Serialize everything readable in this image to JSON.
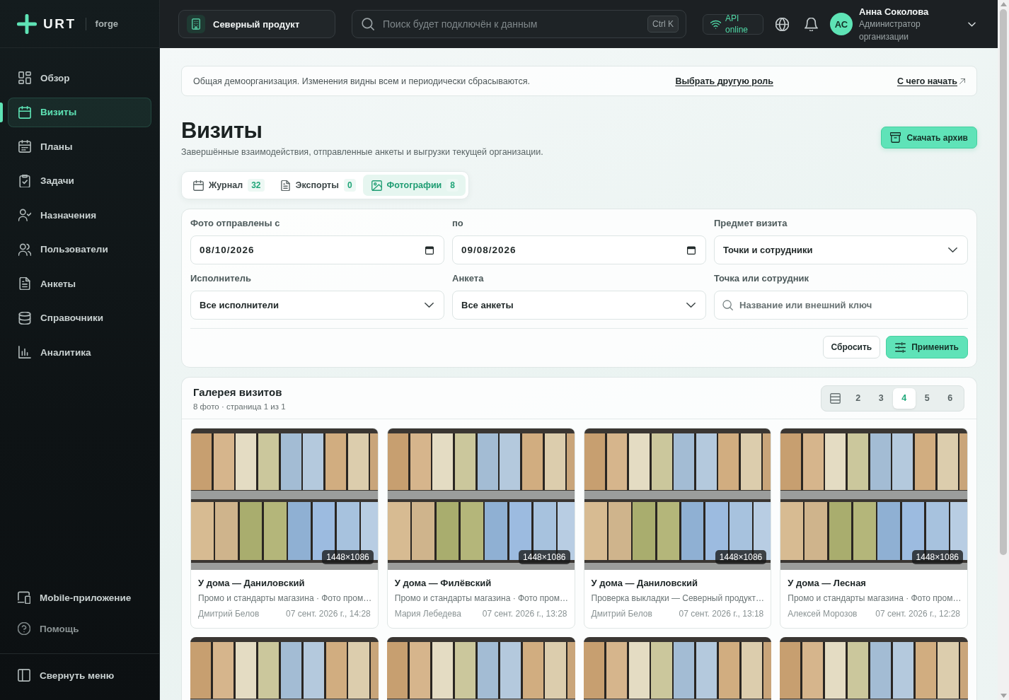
{
  "sidebar": {
    "brand": "URT",
    "product": "forge",
    "nav": [
      {
        "label": "Обзор",
        "selected": false
      },
      {
        "label": "Визиты",
        "selected": true
      },
      {
        "label": "Планы",
        "selected": false
      },
      {
        "label": "Задачи",
        "selected": false
      },
      {
        "label": "Назначения",
        "selected": false
      },
      {
        "label": "Пользователи",
        "selected": false
      },
      {
        "label": "Анкеты",
        "selected": false
      },
      {
        "label": "Справочники",
        "selected": false
      },
      {
        "label": "Аналитика",
        "selected": false
      }
    ],
    "footer": [
      {
        "label": "Mobile-приложение",
        "disabled": false
      },
      {
        "label": "Помощь",
        "disabled": true
      }
    ],
    "collapse": "Свернуть меню"
  },
  "topbar": {
    "organization": "Северный продукт",
    "search": {
      "placeholder": "Поиск будет подключён к данным",
      "shortcut": "Ctrl K"
    },
    "api_status": "API online",
    "user": {
      "initials": "АС",
      "name": "Анна Соколова",
      "role": "Администратор организации"
    }
  },
  "notice": {
    "text": "Общая демоорганизация. Изменения видны всем и периодически сбрасываются.",
    "links": [
      {
        "label": "Выбрать другую роль",
        "external": false
      },
      {
        "label": "С чего начать",
        "external": true
      }
    ]
  },
  "page": {
    "title": "Визиты",
    "subtitle": "Завершённые взаимодействия, отправленные анкеты и выгрузки текущей организации.",
    "action": "Скачать архив"
  },
  "tabs": [
    {
      "label": "Журнал",
      "count": "32",
      "selected": false
    },
    {
      "label": "Экспорты",
      "count": "0",
      "selected": false
    },
    {
      "label": "Фотографии",
      "count": "8",
      "selected": true
    }
  ],
  "filters": {
    "fields": [
      {
        "kind": "date",
        "label": "Фото отправлены с",
        "value": "08/10/2026"
      },
      {
        "kind": "date",
        "label": "по",
        "value": "09/08/2026"
      },
      {
        "kind": "select",
        "label": "Предмет визита",
        "value": "Точки и сотрудники"
      },
      {
        "kind": "select",
        "label": "Исполнитель",
        "value": "Все исполнители"
      },
      {
        "kind": "select",
        "label": "Анкета",
        "value": "Все анкеты"
      },
      {
        "kind": "search",
        "label": "Точка или сотрудник",
        "placeholder": "Название или внешний ключ"
      }
    ],
    "buttons": [
      {
        "kind": "secondary",
        "label": "Сбросить"
      },
      {
        "kind": "primary",
        "label": "Применить"
      }
    ]
  },
  "gallery": {
    "title": "Галерея визитов",
    "subtitle": "8 фото · страница 1 из 1",
    "view_options": [
      {
        "kind": "icon",
        "selected": false
      },
      {
        "kind": "number",
        "label": "2",
        "selected": false
      },
      {
        "kind": "number",
        "label": "3",
        "selected": false
      },
      {
        "kind": "number",
        "label": "4",
        "selected": true
      },
      {
        "kind": "number",
        "label": "5",
        "selected": false
      },
      {
        "kind": "number",
        "label": "6",
        "selected": false
      }
    ],
    "cards": [
      {
        "kind": "card",
        "size": "1448×1086",
        "title": "У дома — Даниловский",
        "description": "Промо и стандарты магазина · Фото пром…",
        "author": "Дмитрий Белов",
        "date": "07 сент. 2026 г., 14:28"
      },
      {
        "kind": "card",
        "size": "1448×1086",
        "title": "У дома — Филёвский",
        "description": "Промо и стандарты магазина · Фото пром…",
        "author": "Мария Лебедева",
        "date": "07 сент. 2026 г., 13:28"
      },
      {
        "kind": "card",
        "size": "1448×1086",
        "title": "У дома — Даниловский",
        "description": "Проверка выкладки — Северный продукт…",
        "author": "Дмитрий Белов",
        "date": "07 сент. 2026 г., 13:18"
      },
      {
        "kind": "card",
        "size": "1448×1086",
        "title": "У дома — Лесная",
        "description": "Промо и стандарты магазина · Фото пром…",
        "author": "Алексей Морозов",
        "date": "07 сент. 2026 г., 12:28"
      },
      {
        "kind": "photo"
      },
      {
        "kind": "photo"
      },
      {
        "kind": "photo"
      },
      {
        "kind": "photo"
      }
    ]
  }
}
